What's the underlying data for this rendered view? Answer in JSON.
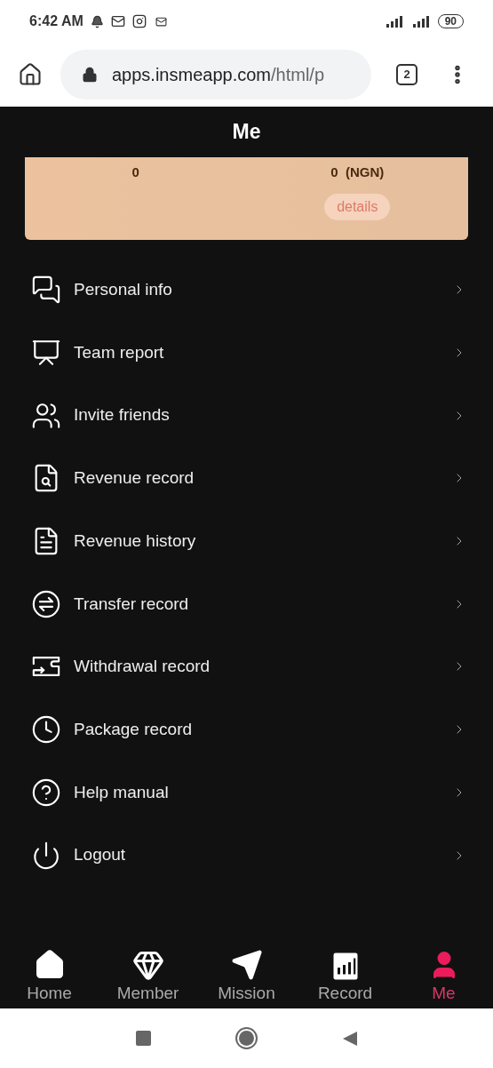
{
  "status_bar": {
    "time": "6:42 AM",
    "battery": "90"
  },
  "browser": {
    "url_host": "apps.insmeapp.com",
    "url_path": "/html/p",
    "tab_count": "2"
  },
  "header": {
    "title": "Me"
  },
  "balance_card": {
    "left_value": "0",
    "right_value": "0  (NGN)",
    "details_button": "details"
  },
  "menu": [
    {
      "label": "Personal info"
    },
    {
      "label": "Team report"
    },
    {
      "label": "Invite friends"
    },
    {
      "label": "Revenue record"
    },
    {
      "label": "Revenue history"
    },
    {
      "label": "Transfer record"
    },
    {
      "label": "Withdrawal record"
    },
    {
      "label": "Package record"
    },
    {
      "label": "Help manual"
    },
    {
      "label": "Logout"
    }
  ],
  "bottom_nav": [
    {
      "label": "Home",
      "selected": false
    },
    {
      "label": "Member",
      "selected": false
    },
    {
      "label": "Mission",
      "selected": false
    },
    {
      "label": "Record",
      "selected": false
    },
    {
      "label": "Me",
      "selected": true
    }
  ]
}
